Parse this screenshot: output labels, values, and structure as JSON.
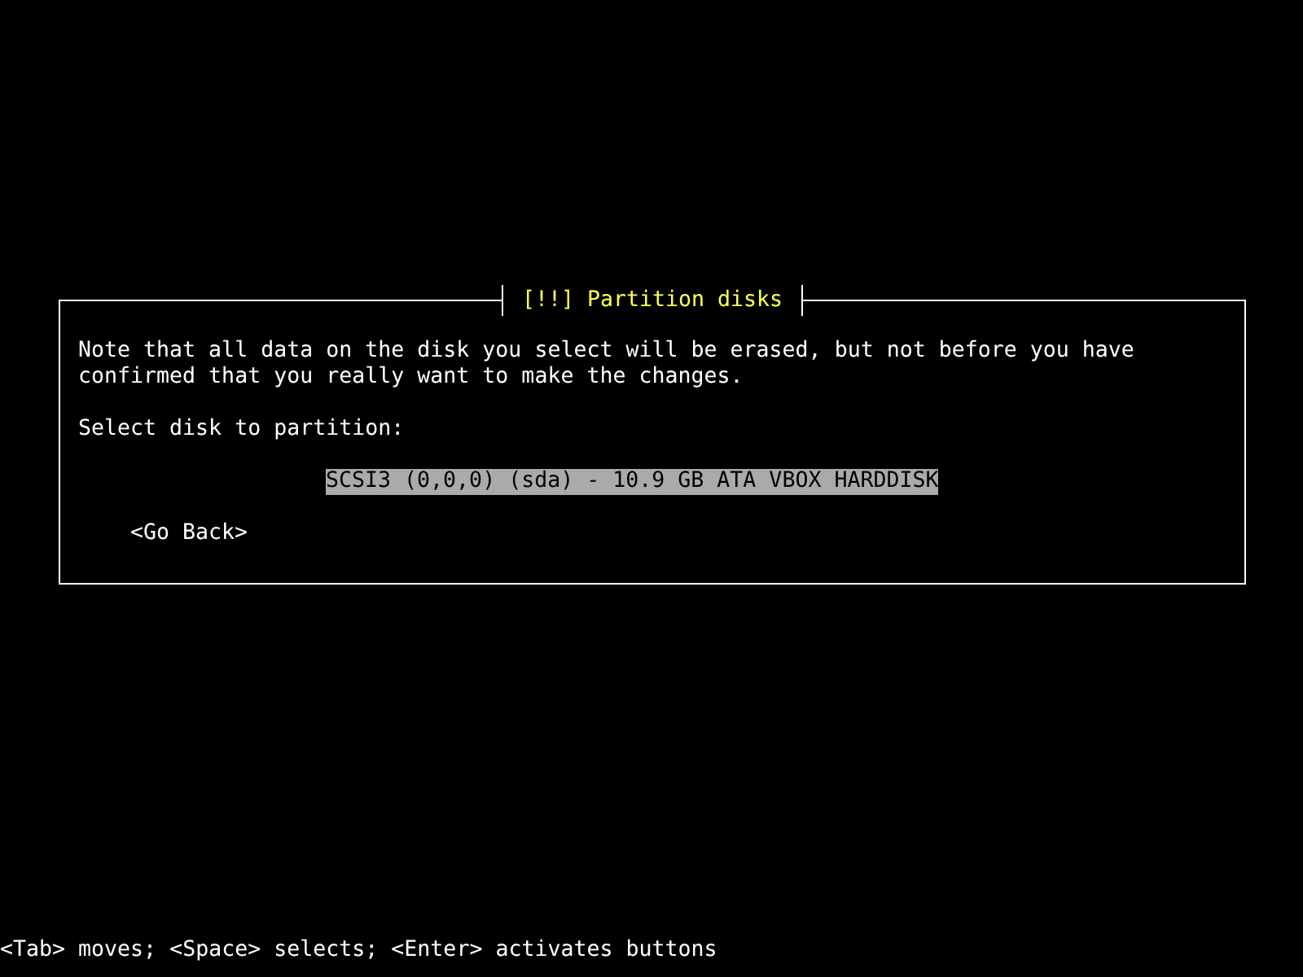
{
  "dialog": {
    "title": "[!!] Partition disks",
    "message": "Note that all data on the disk you select will be erased, but not before you have confirmed that you really want to make the changes.",
    "prompt": "Select disk to partition:",
    "disks": [
      {
        "label": "SCSI3 (0,0,0) (sda) - 10.9 GB ATA VBOX HARDDISK",
        "selected": true
      }
    ],
    "buttons": [
      {
        "label": "<Go Back>"
      }
    ]
  },
  "help_line": "<Tab> moves; <Space> selects; <Enter> activates buttons"
}
